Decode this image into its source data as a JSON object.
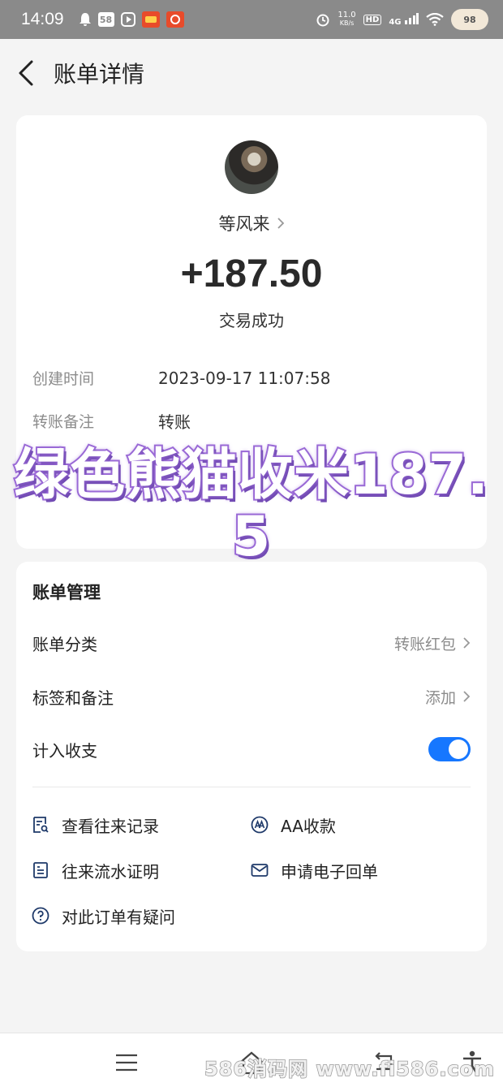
{
  "status_bar": {
    "time": "14:09",
    "badge_58": "58",
    "network_speed_value": "11.0",
    "network_speed_unit": "KB/s",
    "hd_label": "HD",
    "network_type": "4G",
    "battery_level": "98"
  },
  "header": {
    "title": "账单详情"
  },
  "transaction": {
    "payee": "等风来",
    "amount": "+187.50",
    "status": "交易成功",
    "created_label": "创建时间",
    "created_value": "2023-09-17 11:07:58",
    "note_label": "转账备注",
    "note_value": "转账"
  },
  "overlay": {
    "line1": "绿色熊猫收米187.",
    "line2": "5"
  },
  "manage": {
    "title": "账单管理",
    "category_label": "账单分类",
    "category_value": "转账红包",
    "tags_label": "标签和备注",
    "tags_value": "添加",
    "income_label": "计入收支",
    "income_enabled": true,
    "actions": {
      "history": "查看往来记录",
      "aa": "AA收款",
      "statement": "往来流水证明",
      "receipt": "申请电子回单",
      "question": "对此订单有疑问"
    }
  },
  "watermark": "586消码网 www.fi586.com",
  "colors": {
    "accent": "#1677ff",
    "overlay_stroke": "#9a6ad6"
  }
}
